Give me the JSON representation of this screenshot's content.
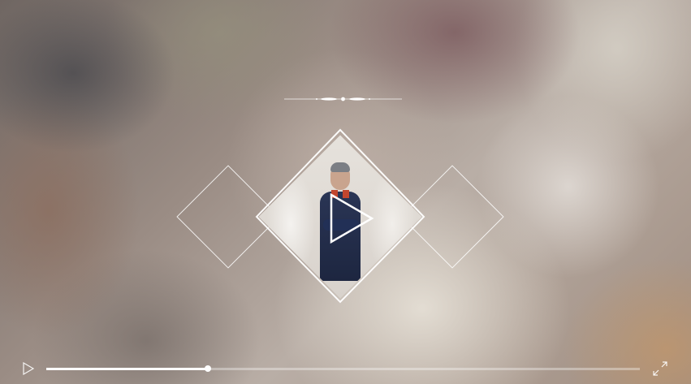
{
  "player": {
    "progress": 0.272,
    "icons": {
      "center_play": "play-icon",
      "control_play": "play-icon",
      "fullscreen": "fullscreen-icon",
      "ornament": "ornament-divider"
    },
    "colors": {
      "accent": "#ffffff",
      "track": "rgba(255,255,255,0.35)"
    }
  }
}
